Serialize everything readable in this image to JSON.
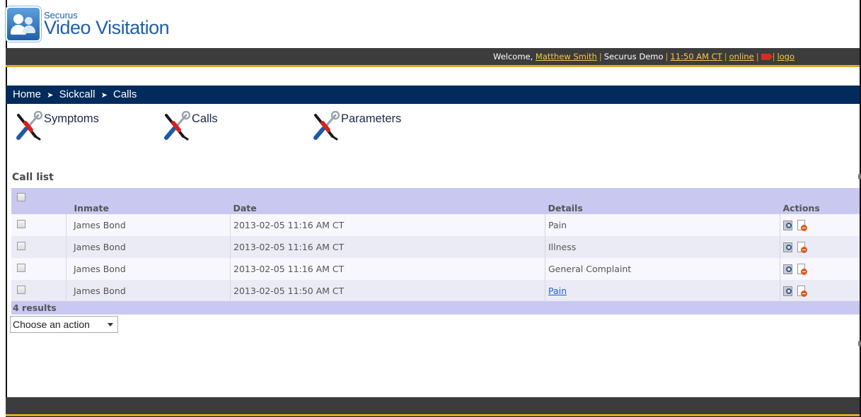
{
  "app": {
    "brand": "Securus",
    "title": "Video Visitation"
  },
  "topbar": {
    "welcome_prefix": "Welcome, ",
    "user_name": "Matthew Smith",
    "facility": "Securus Demo",
    "time": "11:50 AM CT",
    "status": "online",
    "logout_partial": "logo"
  },
  "breadcrumb": {
    "items": [
      "Home",
      "Sickcall",
      "Calls"
    ],
    "separator": "➤"
  },
  "modules": [
    {
      "label": "Symptoms",
      "icon": "tools-icon"
    },
    {
      "label": "Calls",
      "icon": "tools-icon"
    },
    {
      "label": "Parameters",
      "icon": "tools-icon"
    }
  ],
  "call_list": {
    "title": "Call list",
    "columns": [
      "Inmate",
      "Date",
      "Details",
      "Actions"
    ],
    "rows": [
      {
        "inmate": "James Bond",
        "date": "2013-02-05 11:16 AM CT",
        "details": "Pain",
        "details_link": false
      },
      {
        "inmate": "James Bond",
        "date": "2013-02-05 11:16 AM CT",
        "details": "Illness",
        "details_link": false
      },
      {
        "inmate": "James Bond",
        "date": "2013-02-05 11:16 AM CT",
        "details": "General Complaint",
        "details_link": false
      },
      {
        "inmate": "James Bond",
        "date": "2013-02-05 11:50 AM CT",
        "details": "Pain",
        "details_link": true
      }
    ],
    "results_text": "4 results",
    "action_select": "Choose an action"
  },
  "colors": {
    "topbar": "#3c3c3c",
    "accent": "#e7a823",
    "breadcrumb_bar": "#012b5d",
    "table_header": "#c8c8f0"
  }
}
